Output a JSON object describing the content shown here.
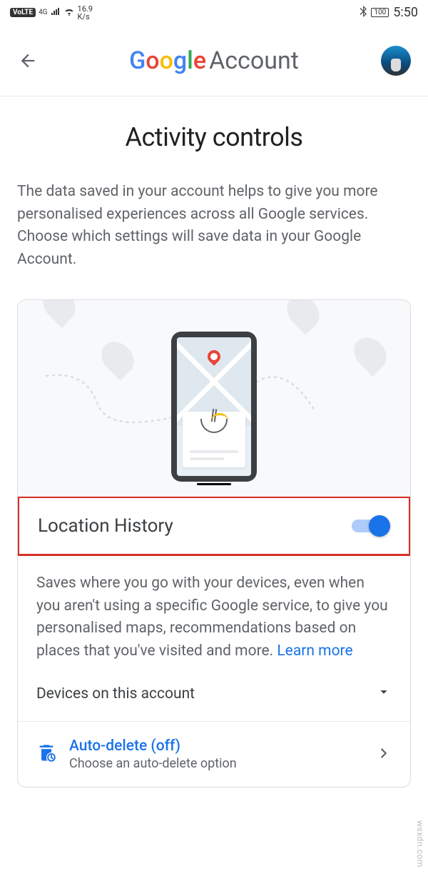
{
  "status_bar": {
    "volte": "VoLTE",
    "network_type": "4G",
    "data_rate_top": "16.9",
    "data_rate_bottom": "K/s",
    "battery": "100",
    "time": "5:50"
  },
  "header": {
    "brand_google": "Google",
    "brand_account": "Account"
  },
  "page": {
    "title": "Activity controls",
    "description": "The data saved in your account helps to give you more personalised experiences across all Google services. Choose which settings will save data in your Google Account."
  },
  "location_history": {
    "title": "Location History",
    "toggle_on": true,
    "description": "Saves where you go with your devices, even when you aren't using a specific Google service, to give you personalised maps, recommendations based on places that you've visited and more. ",
    "learn_more": "Learn more",
    "devices_label": "Devices on this account"
  },
  "auto_delete": {
    "title": "Auto-delete (off)",
    "subtitle": "Choose an auto-delete option"
  },
  "watermark": "wsxdn.com"
}
